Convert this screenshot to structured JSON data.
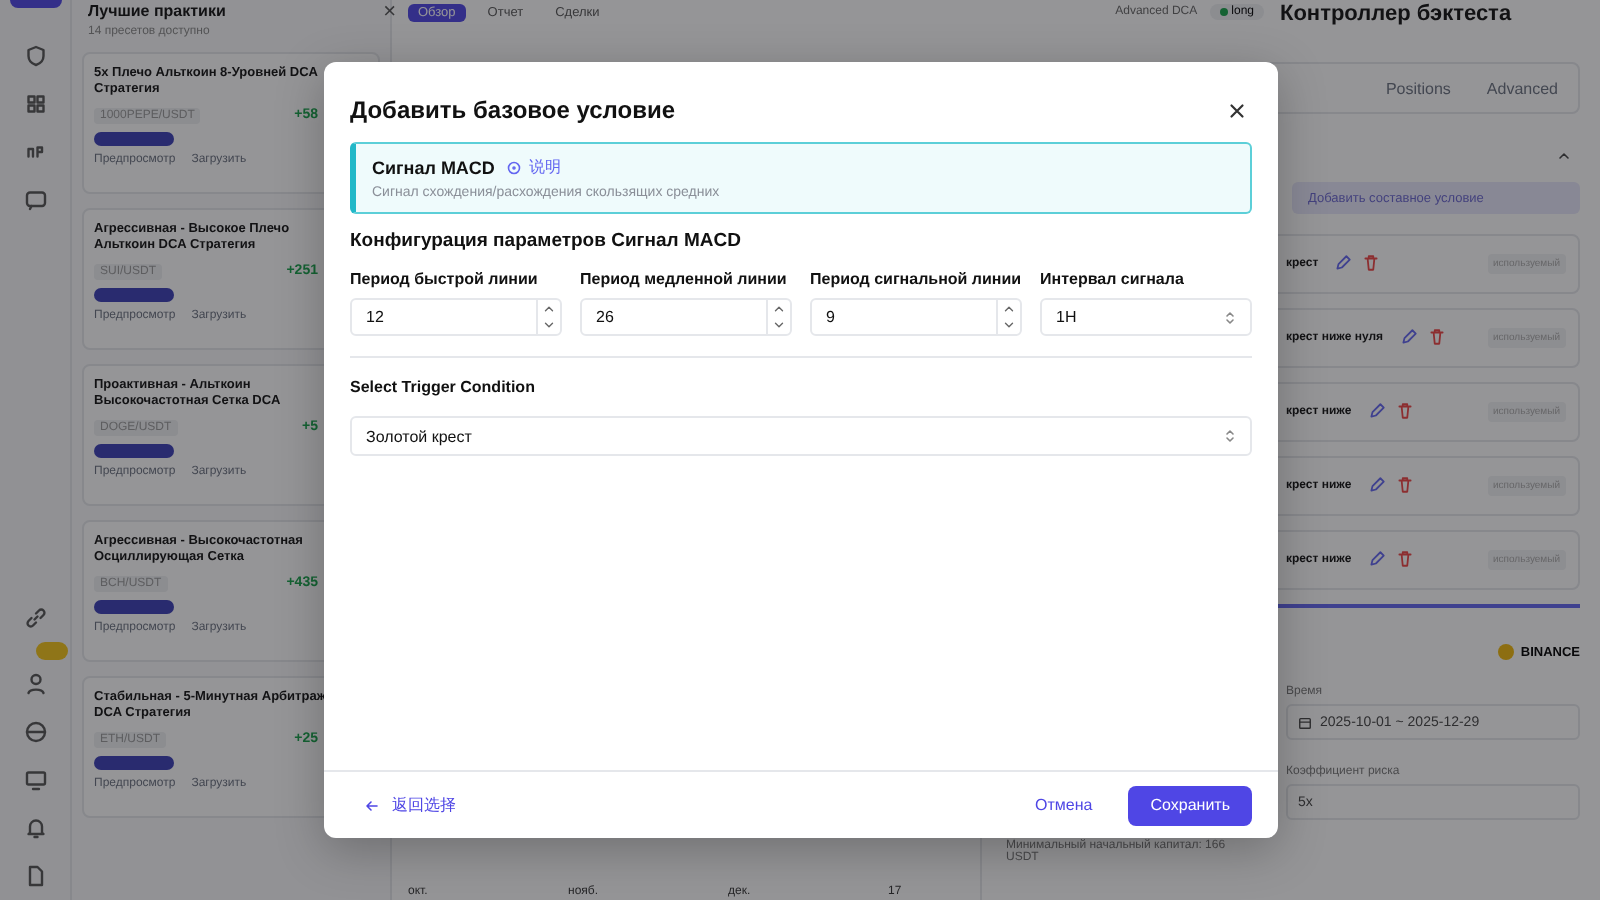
{
  "presets_panel": {
    "title": "Лучшие практики",
    "subtitle": "14 пресетов доступно",
    "close": "×",
    "presets": [
      {
        "name": "5x Плечо Альткоин 8-Уровней DCA Стратегия",
        "pair": "1000PEPE/USDT",
        "return": "+58",
        "preview": "Предпросмотр",
        "load": "Загрузить"
      },
      {
        "name": "Агрессивная - Высокое Плечо Альткоин DCA Стратегия",
        "pair": "SUI/USDT",
        "return": "+251",
        "preview": "Предпросмотр",
        "load": "Загрузить"
      },
      {
        "name": "Проактивная - Альткоин Высокочастотная Сетка DCA",
        "pair": "DOGE/USDT",
        "return": "+5",
        "preview": "Предпросмотр",
        "load": "Загрузить"
      },
      {
        "name": "Агрессивная - Высокочастотная Осциллирующая Сетка",
        "pair": "BCH/USDT",
        "return": "+435",
        "preview": "Предпросмотр",
        "load": "Загрузить"
      },
      {
        "name": "Стабильная - 5-Минутная Арбитраж DCA Стратегия",
        "pair": "ETH/USDT",
        "return": "+25",
        "preview": "Предпросмотр",
        "load": "Загрузить"
      }
    ]
  },
  "report_tabs": [
    {
      "label": "Обзор",
      "selected": true
    },
    {
      "label": "Отчет",
      "selected": false
    },
    {
      "label": "Сделки",
      "selected": false
    }
  ],
  "strategy": {
    "name": "Advanced DCA",
    "direction": "long"
  },
  "chart_axis": [
    "окт.",
    "нояб.",
    "дек.",
    "17"
  ],
  "controller": {
    "title": "Контроллер бэктеста",
    "tabs": [
      {
        "label": "Positions",
        "selected": false
      },
      {
        "label": "Advanced",
        "selected": false
      }
    ],
    "add_button": "Добавить составное условие",
    "conditions": [
      {
        "label": "крест",
        "status": "используемый"
      },
      {
        "label": "крест ниже нуля",
        "status": "используемый"
      },
      {
        "label": "крест ниже",
        "status": "используемый"
      },
      {
        "label": "крест ниже",
        "status": "используемый"
      },
      {
        "label": "крест ниже",
        "status": "используемый"
      }
    ],
    "exchange": "BINANCE",
    "time_label": "Время",
    "date_range": "2025-10-01 ~ 2025-12-29",
    "risk_label": "Коэффициент риска",
    "risk": "5x",
    "min_capital": "Минимальный начальный капитал: 166 USDT"
  },
  "dialog": {
    "title": "Добавить базовое условие",
    "signal": {
      "name": "Сигнал MACD",
      "help": "说明",
      "description": "Сигнал схождения/расхождения скользящих средних"
    },
    "section_title": "Конфигурация параметров Сигнал MACD",
    "fields": [
      {
        "label": "Период быстрой линии",
        "value": "12",
        "kind": "number"
      },
      {
        "label": "Период медленной линии",
        "value": "26",
        "kind": "number"
      },
      {
        "label": "Период сигнальной линии",
        "value": "9",
        "kind": "number"
      },
      {
        "label": "Интервал сигнала",
        "value": "1H",
        "kind": "select"
      }
    ],
    "trigger": {
      "label": "Select Trigger Condition",
      "value": "Золотой крест"
    },
    "back": "返回选择",
    "cancel": "Отмена",
    "save": "Сохранить"
  }
}
